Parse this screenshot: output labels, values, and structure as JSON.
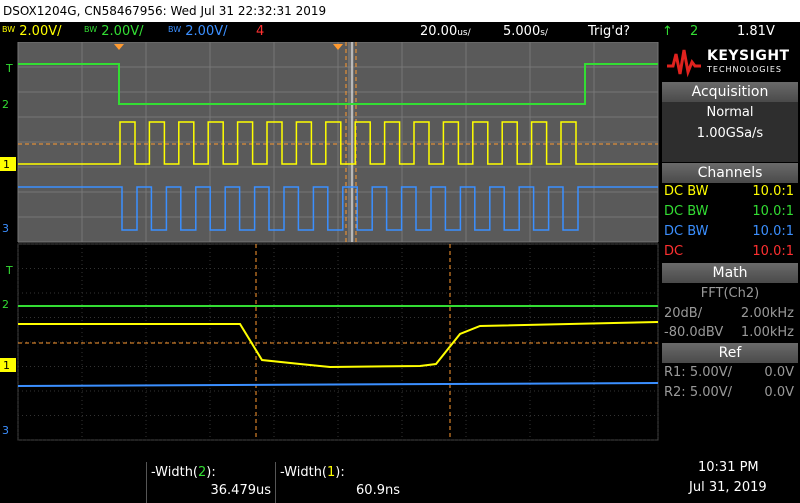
{
  "title_bar": {
    "text": "DSOX1204G, CN58467956: Wed Jul 31 22:32:31 2019"
  },
  "channels_top": [
    {
      "bw": "BW",
      "scale": "2.00V/",
      "color": "#ffff00"
    },
    {
      "bw": "BW",
      "scale": "2.00V/",
      "color": "#33dd33"
    },
    {
      "bw": "BW",
      "scale": "2.00V/",
      "color": "#3b8fff"
    },
    {
      "bw": "",
      "scale": "4",
      "color": "#ff3030"
    }
  ],
  "timebase": {
    "scale": "20.00",
    "scale_unit": "us/",
    "delay": "5.000",
    "delay_unit": "s/"
  },
  "trigger": {
    "status": "Trig'd?",
    "source": "2",
    "level": "1.81V",
    "arrow": "↑"
  },
  "brand": {
    "name": "KEYSIGHT",
    "sub": "TECHNOLOGIES"
  },
  "acquisition": {
    "header": "Acquisition",
    "mode": "Normal",
    "rate": "1.00GSa/s"
  },
  "channels_panel": {
    "header": "Channels",
    "rows": [
      {
        "label": "DC BW",
        "value": "10.0:1",
        "color": "#ffff00"
      },
      {
        "label": "DC BW",
        "value": "10.0:1",
        "color": "#33dd33"
      },
      {
        "label": "DC BW",
        "value": "10.0:1",
        "color": "#3b8fff"
      },
      {
        "label": "DC",
        "value": "10.0:1",
        "color": "#ff3030"
      }
    ]
  },
  "math": {
    "header": "Math",
    "func": "FFT(Ch2)",
    "row1_left": "20dB/",
    "row1_right": "2.00kHz",
    "row2_left": "-80.0dBV",
    "row2_right": "1.00kHz"
  },
  "ref": {
    "header": "Ref",
    "rows": [
      {
        "label": "R1:",
        "scale": "5.00V/",
        "offset": "0.0V"
      },
      {
        "label": "R2:",
        "scale": "5.00V/",
        "offset": "0.0V"
      }
    ]
  },
  "measurements": [
    {
      "label": "-Width(",
      "ch": "2",
      "end": "):",
      "value": "36.479us",
      "ch_color": "#33dd33"
    },
    {
      "label": "-Width(",
      "ch": "1",
      "end": "):",
      "value": "60.9ns",
      "ch_color": "#ffff00"
    }
  ],
  "clock": {
    "time": "10:31 PM",
    "date": "Jul 31, 2019"
  },
  "markers": {
    "t": "T",
    "ch1": "1",
    "ch2": "2",
    "ch3": "3"
  },
  "colors": {
    "ch1": "#ffff00",
    "ch2": "#33dd33",
    "ch3": "#3b8fff",
    "ch4": "#ff3030",
    "cursor": "#ff9a30",
    "grid_bg_top": "#5a5a5a"
  }
}
